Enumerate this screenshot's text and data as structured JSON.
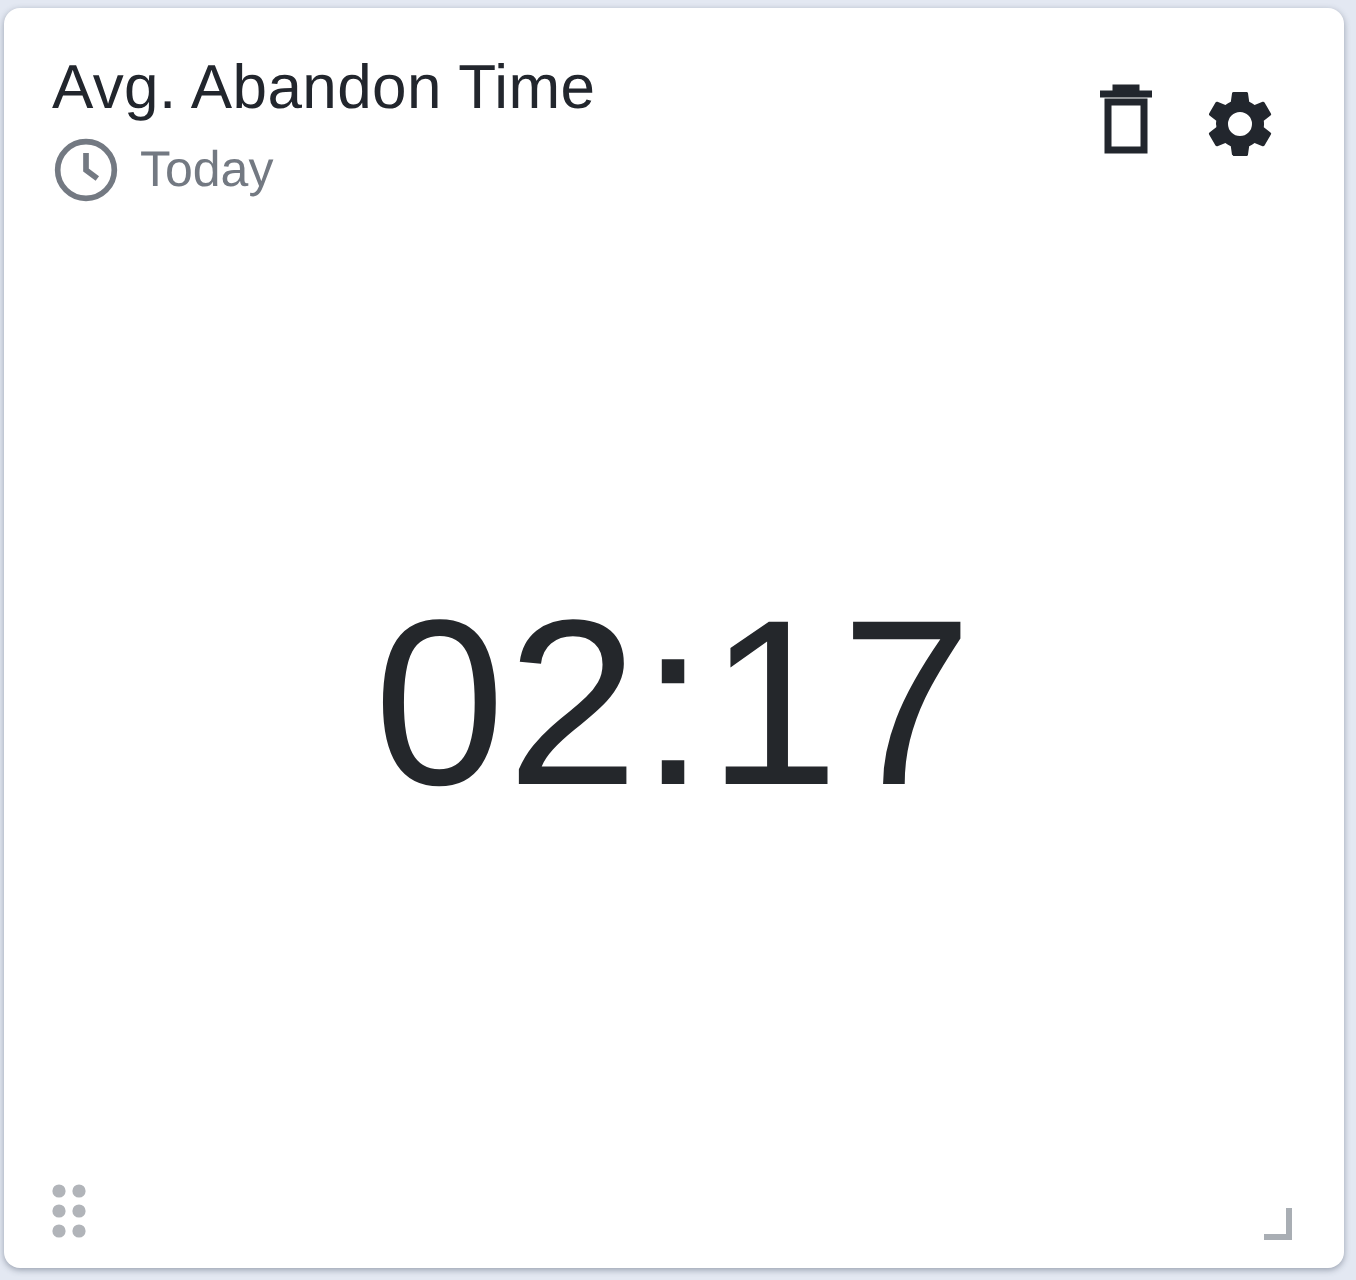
{
  "widget": {
    "title": "Avg. Abandon Time",
    "period": "Today",
    "value": "02:17"
  }
}
